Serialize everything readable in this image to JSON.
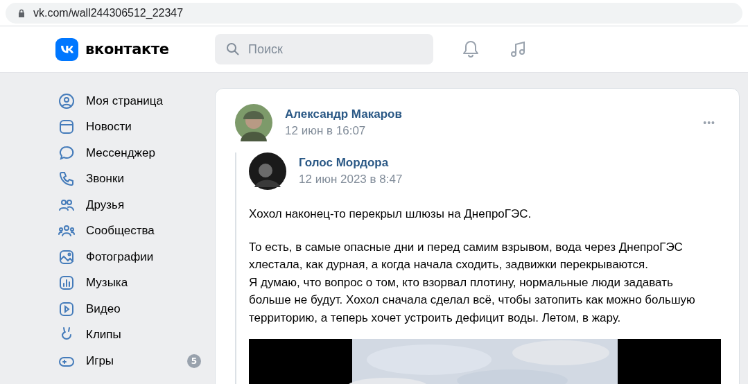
{
  "browser": {
    "url": "vk.com/wall244306512_22347"
  },
  "header": {
    "logo": "вконтакте",
    "search": {
      "placeholder": "Поиск"
    }
  },
  "sidebar": {
    "items": [
      {
        "kind": "profile",
        "label": "Моя страница"
      },
      {
        "kind": "news",
        "label": "Новости"
      },
      {
        "kind": "messenger",
        "label": "Мессенджер"
      },
      {
        "kind": "calls",
        "label": "Звонки"
      },
      {
        "kind": "friends",
        "label": "Друзья"
      },
      {
        "kind": "communities",
        "label": "Сообщества"
      },
      {
        "kind": "photos",
        "label": "Фотографии"
      },
      {
        "kind": "music",
        "label": "Музыка"
      },
      {
        "kind": "video",
        "label": "Видео"
      },
      {
        "kind": "clips",
        "label": "Клипы"
      },
      {
        "kind": "games",
        "label": "Игры",
        "badge": "5"
      }
    ]
  },
  "post": {
    "author": "Александр Макаров",
    "date": "12 июн в 16:07",
    "more": "•••",
    "repost": {
      "author": "Голос Мордора",
      "date": "12 июн 2023 в 8:47",
      "paragraphs": [
        "Хохол наконец-то перекрыл шлюзы на ДнепроГЭС.",
        "То есть, в самые опасные дни и перед самим взрывом, вода через ДнепроГЭС хлестала, как дурная, а когда начала сходить, задвижки перекрываются.\nЯ думаю, что вопрос о том, кто взорвал плотину, нормальные люди задавать больше не будут. Хохол сначала сделал всё, чтобы затопить как можно большую территорию, а теперь хочет устроить дефицит воды. Летом, в жару."
      ]
    }
  }
}
